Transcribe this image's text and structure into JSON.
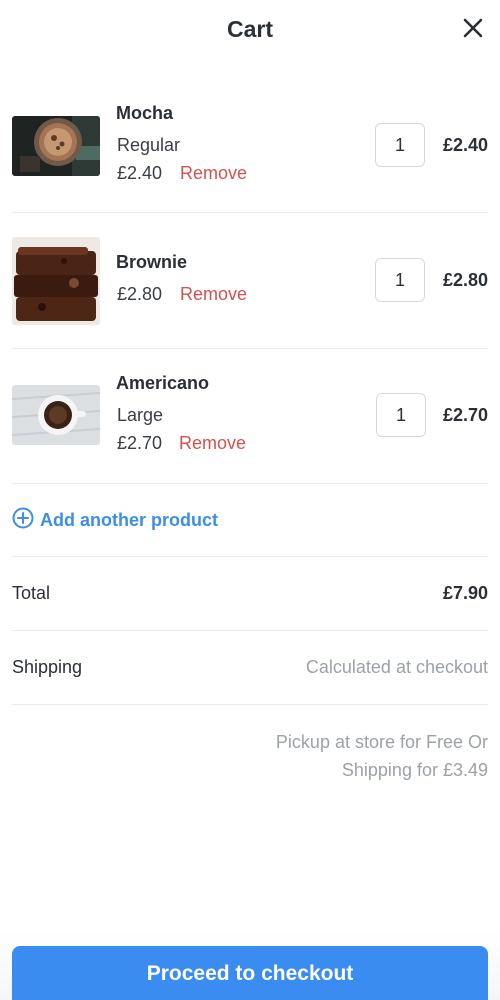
{
  "header": {
    "title": "Cart",
    "close_icon": "close-icon"
  },
  "items": [
    {
      "name": "Mocha",
      "variant": "Regular",
      "unit_price": "£2.40",
      "remove_label": "Remove",
      "quantity": "1",
      "line_total": "£2.40",
      "image": "mocha-photo"
    },
    {
      "name": "Brownie",
      "variant": "",
      "unit_price": "£2.80",
      "remove_label": "Remove",
      "quantity": "1",
      "line_total": "£2.80",
      "image": "brownie-photo"
    },
    {
      "name": "Americano",
      "variant": "Large",
      "unit_price": "£2.70",
      "remove_label": "Remove",
      "quantity": "1",
      "line_total": "£2.70",
      "image": "americano-photo"
    }
  ],
  "add_product": {
    "label": "Add another product",
    "icon": "plus-circle-icon"
  },
  "summary": {
    "total_label": "Total",
    "total_value": "£7.90",
    "shipping_label": "Shipping",
    "shipping_value": "Calculated at checkout",
    "note_line1": "Pickup at store for Free Or",
    "note_line2": "Shipping for £3.49"
  },
  "checkout": {
    "label": "Proceed to checkout"
  },
  "colors": {
    "accent": "#3b8cf0",
    "link": "#3d8ee6",
    "remove": "#d2524f",
    "muted": "#9da2a9"
  }
}
